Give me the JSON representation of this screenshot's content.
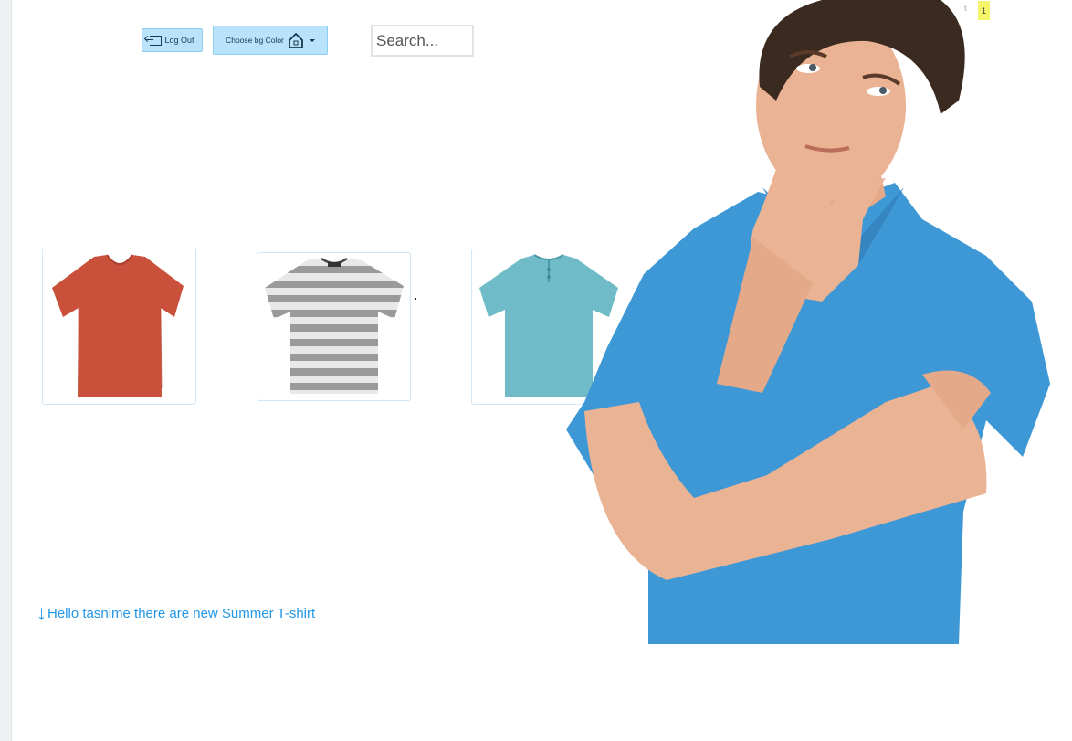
{
  "toolbar": {
    "logout_label": "Log Out",
    "color_label": "Choose bg Color",
    "search_placeholder": "Search..."
  },
  "top_right": {
    "text": "t",
    "badge": "1"
  },
  "products": [
    {
      "name": "Red V-neck T-shirt",
      "color": "#c9513b"
    },
    {
      "name": "Grey striped T-shirt",
      "color": "#bdbdbd"
    },
    {
      "name": "Aqua Henley T-shirt",
      "color": "#6fbcc8"
    }
  ],
  "message": {
    "text": "Hello tasnime there are new Summer T-shirt"
  },
  "colors": {
    "accent": "#2196e6",
    "button_bg": "#b9e3fb",
    "badge_bg": "#f5f56a",
    "shirt_blue": "#3f98d6"
  }
}
